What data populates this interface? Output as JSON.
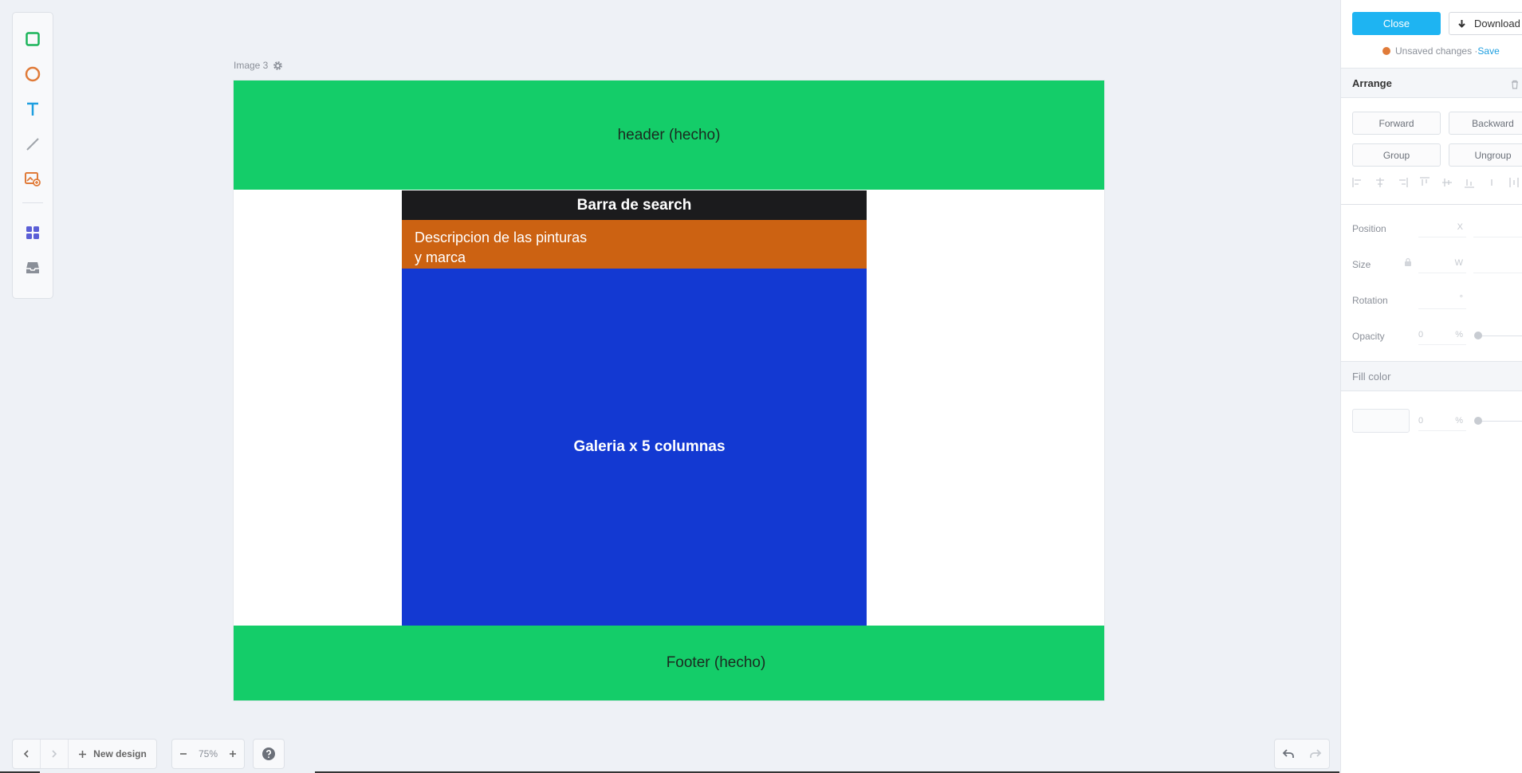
{
  "toolbar": {
    "tools": [
      {
        "name": "rectangle-tool",
        "icon": "square-icon",
        "color": "#1bb45a"
      },
      {
        "name": "ellipse-tool",
        "icon": "circle-icon",
        "color": "#e07b39"
      },
      {
        "name": "text-tool",
        "icon": "text-icon",
        "color": "#1e9fe0"
      },
      {
        "name": "line-tool",
        "icon": "line-icon",
        "color": "#a0a4aa"
      },
      {
        "name": "image-tool",
        "icon": "image-icon",
        "color": "#e07b39"
      },
      {
        "name": "components-tool",
        "icon": "grid-icon",
        "color": "#5b5fd6"
      },
      {
        "name": "library-tool",
        "icon": "inbox-icon",
        "color": "#8a8f98"
      }
    ]
  },
  "canvas": {
    "label": "Image 3",
    "blocks": {
      "header": "header (hecho)",
      "search": "Barra de search",
      "description": "Descripcion de las pinturas\ny marca",
      "gallery": "Galeria x 5 columnas",
      "footer": "Footer (hecho)"
    },
    "colors": {
      "header": "#14cd69",
      "search": "#1b1b1d",
      "description": "#cc6212",
      "gallery": "#1339d2",
      "footer": "#14cd69"
    }
  },
  "bottom_bar": {
    "new_design": "New design",
    "zoom": "75%"
  },
  "panel": {
    "close": "Close",
    "download": "Download",
    "unsaved": "Unsaved changes · ",
    "save": "Save",
    "arrange": {
      "title": "Arrange",
      "forward": "Forward",
      "backward": "Backward",
      "group": "Group",
      "ungroup": "Ungroup"
    },
    "props": {
      "position": "Position",
      "size": "Size",
      "rotation": "Rotation",
      "opacity": "Opacity",
      "opacity_value": "0",
      "x_suffix": "X",
      "w_suffix": "W",
      "deg_suffix": "°",
      "pct_suffix": "%"
    },
    "fill": {
      "title": "Fill color",
      "opacity_value": "0",
      "pct_suffix": "%"
    }
  }
}
